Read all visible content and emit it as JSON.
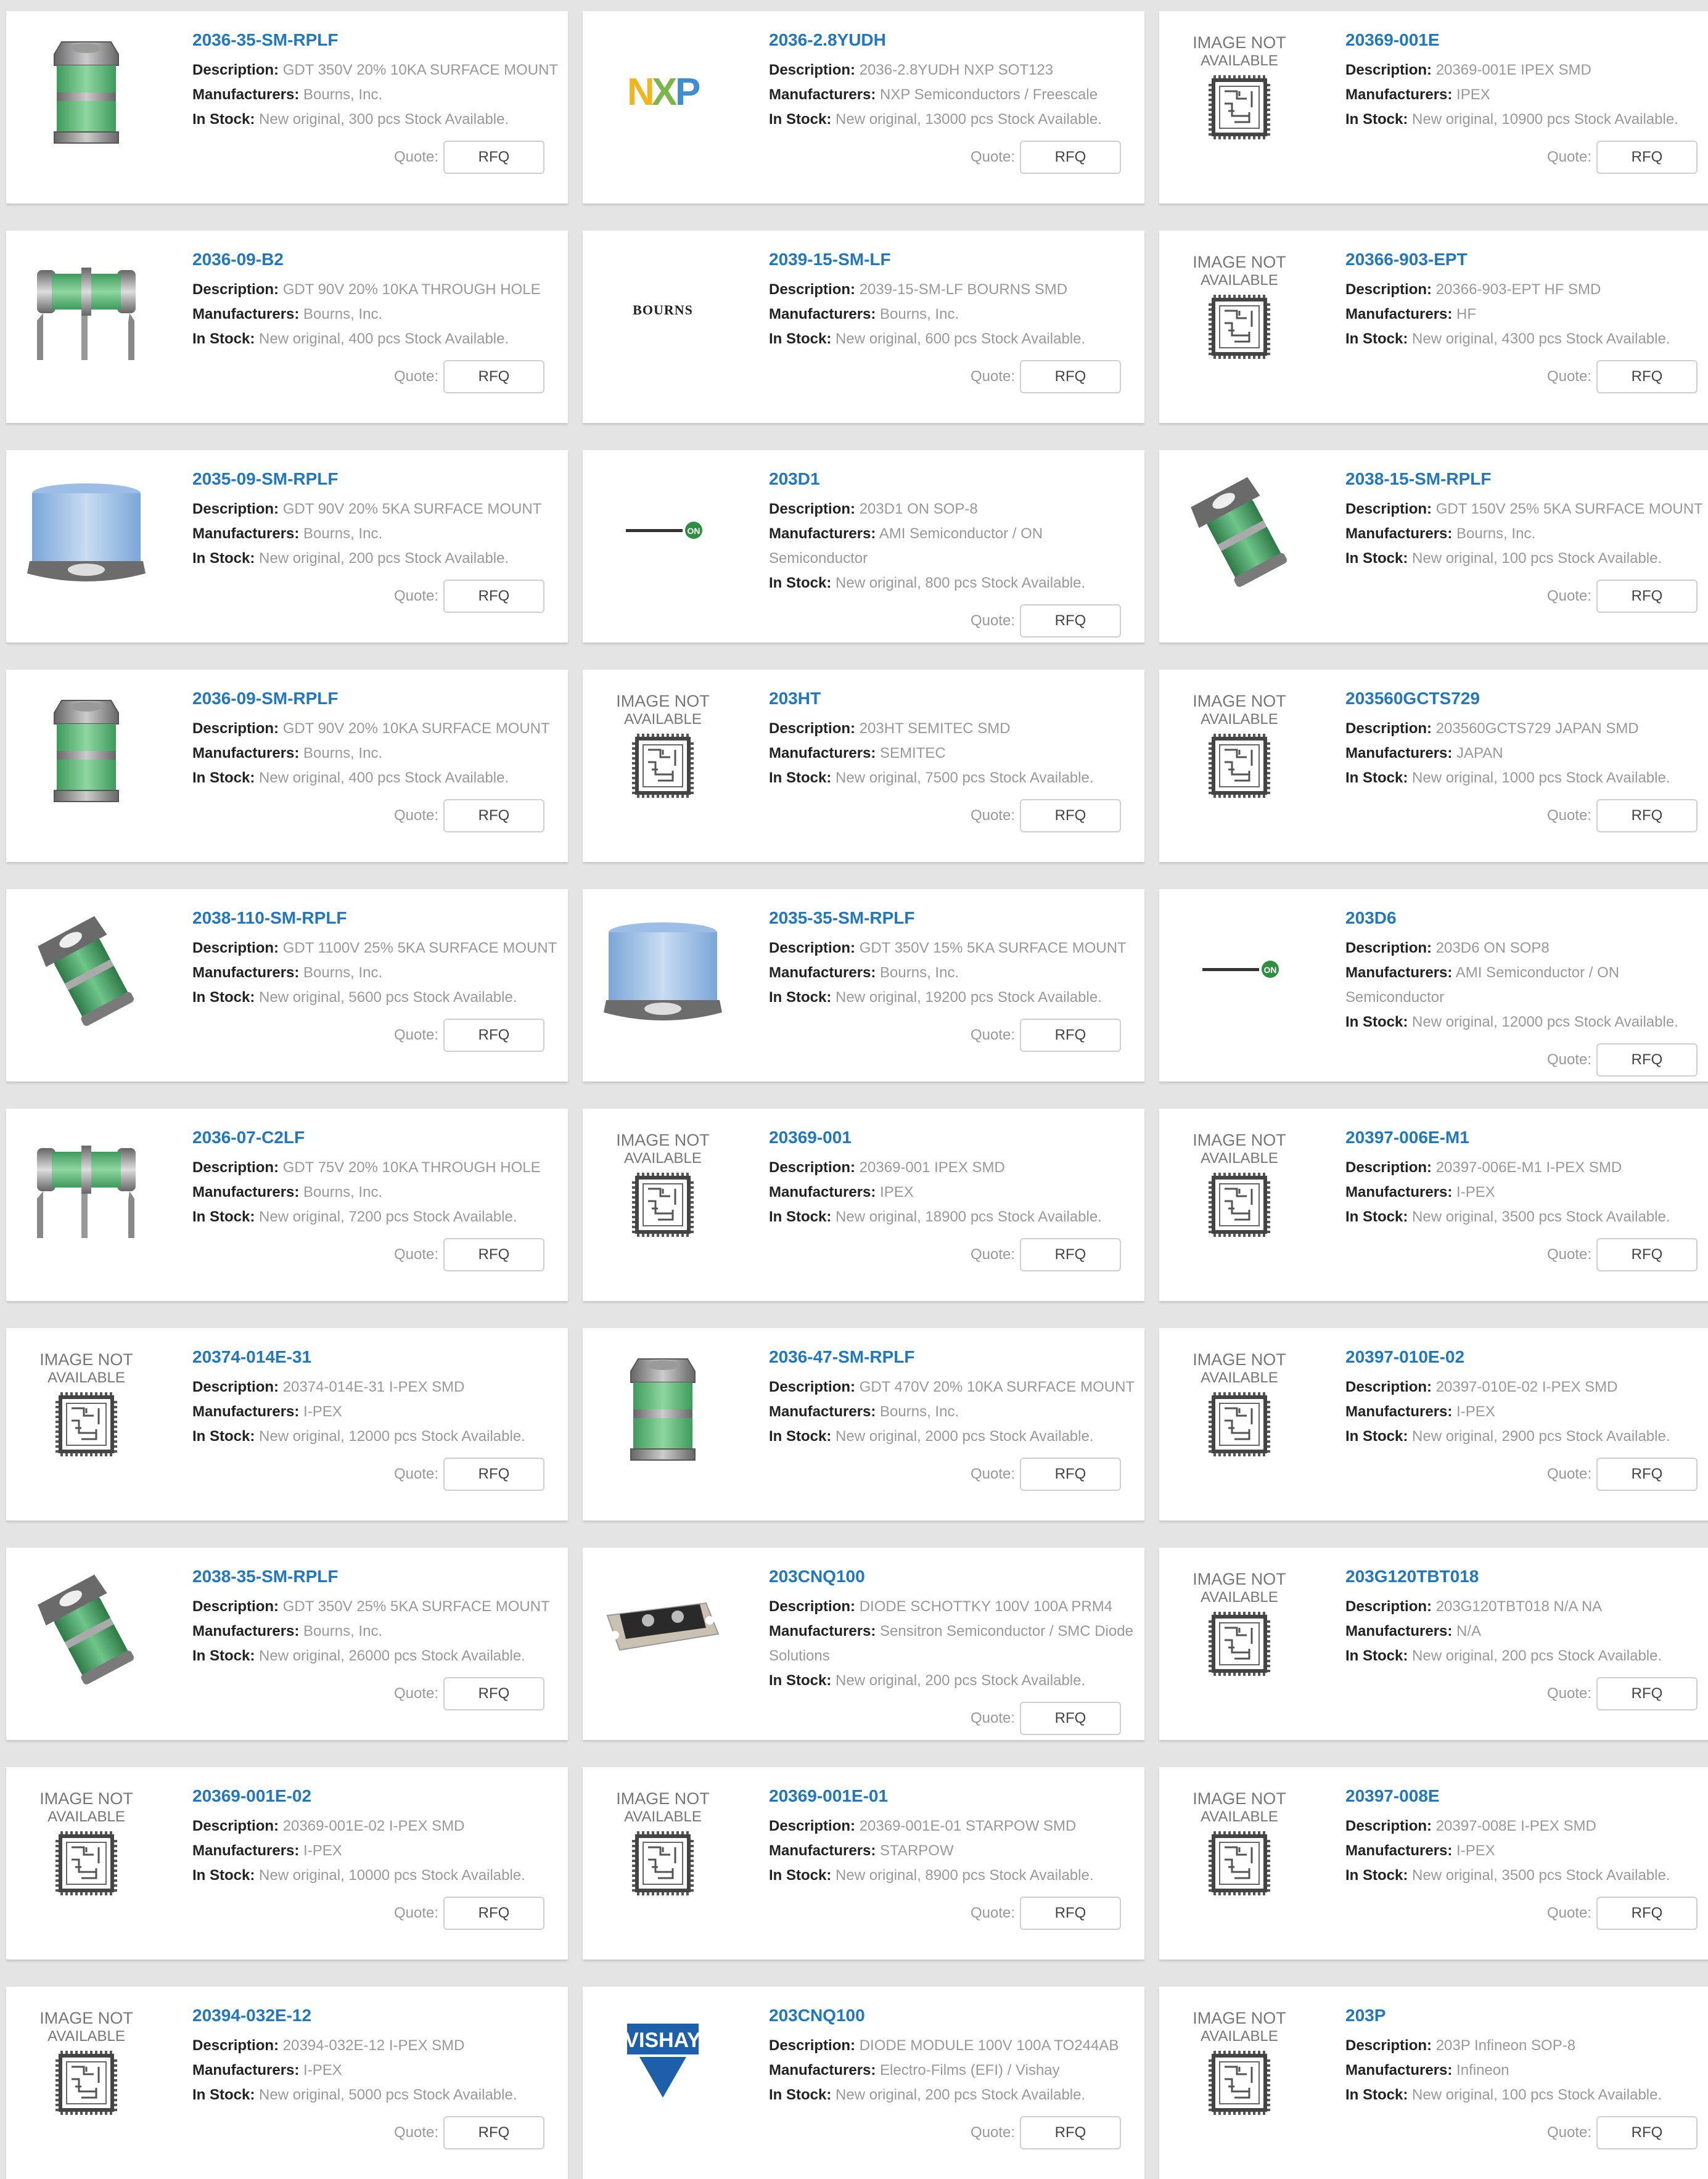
{
  "labels": {
    "description": "Description:",
    "manufacturers": "Manufacturers:",
    "in_stock": "In Stock:",
    "quote": "Quote:",
    "rfq": "RFQ",
    "image_not_available_line1": "IMAGE NOT",
    "image_not_available_line2": "AVAILABLE"
  },
  "colors": {
    "page_background": "#e4e4e4",
    "card_background": "#ffffff",
    "title_link": "#1f78c1",
    "label_text": "#222222",
    "value_text": "#999999"
  },
  "products": [
    {
      "title": "2036-35-SM-RPLF",
      "description": "GDT 350V 20% 10KA SURFACE MOUNT",
      "manufacturer": "Bourns, Inc.",
      "stock": "New original, 300 pcs Stock Available.",
      "image": "gdt-green-smd"
    },
    {
      "title": "2036-2.8YUDH",
      "description": "2036-2.8YUDH NXP SOT123",
      "manufacturer": "NXP Semiconductors / Freescale",
      "stock": "New original, 13000 pcs Stock Available.",
      "image": "nxp-logo"
    },
    {
      "title": "20369-001E",
      "description": "20369-001E IPEX SMD",
      "manufacturer": "IPEX",
      "stock": "New original, 10900 pcs Stock Available.",
      "image": "image-not-available"
    },
    {
      "title": "2036-09-B2",
      "description": "GDT 90V 20% 10KA THROUGH HOLE",
      "manufacturer": "Bourns, Inc.",
      "stock": "New original, 400 pcs Stock Available.",
      "image": "gdt-green-tht"
    },
    {
      "title": "2039-15-SM-LF",
      "description": "2039-15-SM-LF BOURNS SMD",
      "manufacturer": "Bourns, Inc.",
      "stock": "New original, 600 pcs Stock Available.",
      "image": "bourns-logo"
    },
    {
      "title": "20366-903-EPT",
      "description": "20366-903-EPT HF SMD",
      "manufacturer": "HF",
      "stock": "New original, 4300 pcs Stock Available.",
      "image": "image-not-available"
    },
    {
      "title": "2035-09-SM-RPLF",
      "description": "GDT 90V 20% 5KA SURFACE MOUNT",
      "manufacturer": "Bourns, Inc.",
      "stock": "New original, 200 pcs Stock Available.",
      "image": "gdt-blue"
    },
    {
      "title": "203D1",
      "description": "203D1 ON SOP-8",
      "manufacturer": "AMI Semiconductor / ON Semiconductor",
      "stock": "New original, 800 pcs Stock Available.",
      "image": "onsemi-logo"
    },
    {
      "title": "2038-15-SM-RPLF",
      "description": "GDT 150V 25% 5KA SURFACE MOUNT",
      "manufacturer": "Bourns, Inc.",
      "stock": "New original, 100 pcs Stock Available.",
      "image": "gdt-green-tilted"
    },
    {
      "title": "2036-09-SM-RPLF",
      "description": "GDT 90V 20% 10KA SURFACE MOUNT",
      "manufacturer": "Bourns, Inc.",
      "stock": "New original, 400 pcs Stock Available.",
      "image": "gdt-green-smd"
    },
    {
      "title": "203HT",
      "description": "203HT SEMITEC SMD",
      "manufacturer": "SEMITEC",
      "stock": "New original, 7500 pcs Stock Available.",
      "image": "image-not-available"
    },
    {
      "title": "203560GCTS729",
      "description": "203560GCTS729 JAPAN SMD",
      "manufacturer": "JAPAN",
      "stock": "New original, 1000 pcs Stock Available.",
      "image": "image-not-available"
    },
    {
      "title": "2038-110-SM-RPLF",
      "description": "GDT 1100V 25% 5KA SURFACE MOUNT",
      "manufacturer": "Bourns, Inc.",
      "stock": "New original, 5600 pcs Stock Available.",
      "image": "gdt-green-tilted"
    },
    {
      "title": "2035-35-SM-RPLF",
      "description": "GDT 350V 15% 5KA SURFACE MOUNT",
      "manufacturer": "Bourns, Inc.",
      "stock": "New original, 19200 pcs Stock Available.",
      "image": "gdt-blue"
    },
    {
      "title": "203D6",
      "description": "203D6 ON SOP8",
      "manufacturer": "AMI Semiconductor / ON Semiconductor",
      "stock": "New original, 12000 pcs Stock Available.",
      "image": "onsemi-logo"
    },
    {
      "title": "2036-07-C2LF",
      "description": "GDT 75V 20% 10KA THROUGH HOLE",
      "manufacturer": "Bourns, Inc.",
      "stock": "New original, 7200 pcs Stock Available.",
      "image": "gdt-green-tht"
    },
    {
      "title": "20369-001",
      "description": "20369-001 IPEX SMD",
      "manufacturer": "IPEX",
      "stock": "New original, 18900 pcs Stock Available.",
      "image": "image-not-available"
    },
    {
      "title": "20397-006E-M1",
      "description": "20397-006E-M1 I-PEX SMD",
      "manufacturer": "I-PEX",
      "stock": "New original, 3500 pcs Stock Available.",
      "image": "image-not-available"
    },
    {
      "title": "20374-014E-31",
      "description": "20374-014E-31 I-PEX SMD",
      "manufacturer": "I-PEX",
      "stock": "New original, 12000 pcs Stock Available.",
      "image": "image-not-available"
    },
    {
      "title": "2036-47-SM-RPLF",
      "description": "GDT 470V 20% 10KA SURFACE MOUNT",
      "manufacturer": "Bourns, Inc.",
      "stock": "New original, 2000 pcs Stock Available.",
      "image": "gdt-green-smd"
    },
    {
      "title": "20397-010E-02",
      "description": "20397-010E-02 I-PEX SMD",
      "manufacturer": "I-PEX",
      "stock": "New original, 2900 pcs Stock Available.",
      "image": "image-not-available"
    },
    {
      "title": "2038-35-SM-RPLF",
      "description": "GDT 350V 25% 5KA SURFACE MOUNT",
      "manufacturer": "Bourns, Inc.",
      "stock": "New original, 26000 pcs Stock Available.",
      "image": "gdt-green-tilted"
    },
    {
      "title": "203CNQ100",
      "description": "DIODE SCHOTTKY 100V 100A PRM4",
      "manufacturer": "Sensitron Semiconductor / SMC Diode Solutions",
      "stock": "New original, 200 pcs Stock Available.",
      "image": "diode-module"
    },
    {
      "title": "203G120TBT018",
      "description": "203G120TBT018 N/A NA",
      "manufacturer": "N/A",
      "stock": "New original, 200 pcs Stock Available.",
      "image": "image-not-available"
    },
    {
      "title": "20369-001E-02",
      "description": "20369-001E-02 I-PEX SMD",
      "manufacturer": "I-PEX",
      "stock": "New original, 10000 pcs Stock Available.",
      "image": "image-not-available"
    },
    {
      "title": "20369-001E-01",
      "description": "20369-001E-01 STARPOW SMD",
      "manufacturer": "STARPOW",
      "stock": "New original, 8900 pcs Stock Available.",
      "image": "image-not-available"
    },
    {
      "title": "20397-008E",
      "description": "20397-008E I-PEX SMD",
      "manufacturer": "I-PEX",
      "stock": "New original, 3500 pcs Stock Available.",
      "image": "image-not-available"
    },
    {
      "title": "20394-032E-12",
      "description": "20394-032E-12 I-PEX SMD",
      "manufacturer": "I-PEX",
      "stock": "New original, 5000 pcs Stock Available.",
      "image": "image-not-available"
    },
    {
      "title": "203CNQ100",
      "description": "DIODE MODULE 100V 100A TO244AB",
      "manufacturer": "Electro-Films (EFI) / Vishay",
      "stock": "New original, 200 pcs Stock Available.",
      "image": "vishay-logo"
    },
    {
      "title": "203P",
      "description": "203P Infineon SOP-8",
      "manufacturer": "Infineon",
      "stock": "New original, 100 pcs Stock Available.",
      "image": "image-not-available"
    }
  ]
}
